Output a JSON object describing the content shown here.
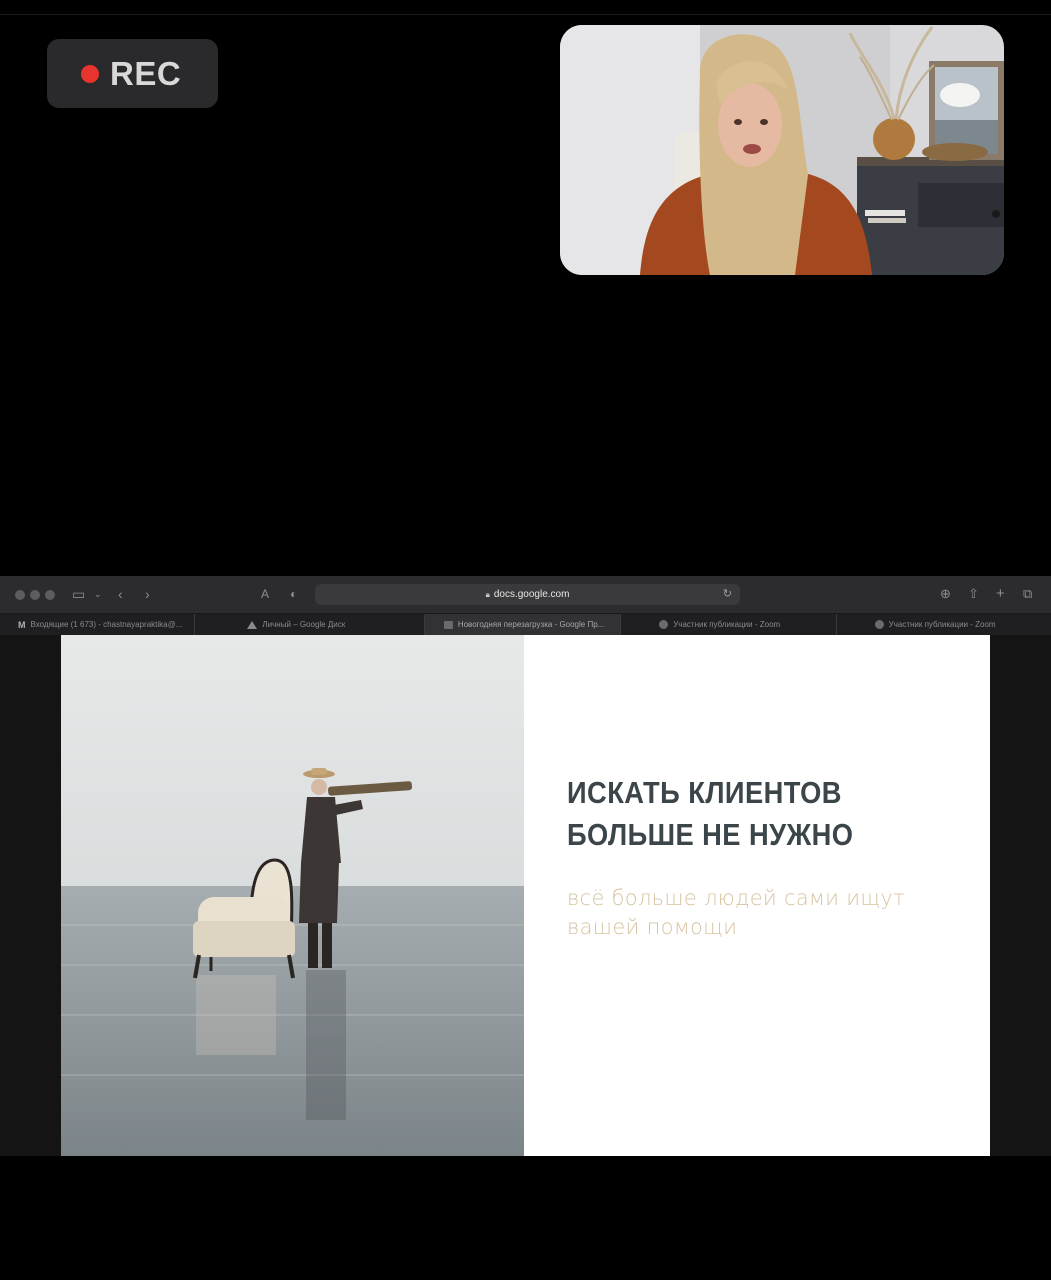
{
  "recording": {
    "label": "REC",
    "dot_color": "#e8342e"
  },
  "browser": {
    "url": "docs.google.com",
    "tabs": [
      {
        "title": "Входящие (1 673) - chastnayapraktika@...",
        "icon": "gmail-icon"
      },
      {
        "title": "Личный – Google Диск",
        "icon": "google-drive-icon"
      },
      {
        "title": "Новогодняя перезагрузка - Google Пр...",
        "icon": "google-slides-icon",
        "active": true
      },
      {
        "title": "Участник публикации - Zoom",
        "icon": "zoom-icon"
      },
      {
        "title": "Участник публикации - Zoom",
        "icon": "zoom-icon"
      }
    ]
  },
  "slide": {
    "title_line1": "ИСКАТЬ КЛИЕНТОВ",
    "title_line2": "БОЛЬШЕ НЕ НУЖНО",
    "subtitle_line1": "всё больше людей сами ищут",
    "subtitle_line2": "вашей помощи",
    "title_color": "#3b454a",
    "subtitle_color": "#d7c4a2"
  }
}
